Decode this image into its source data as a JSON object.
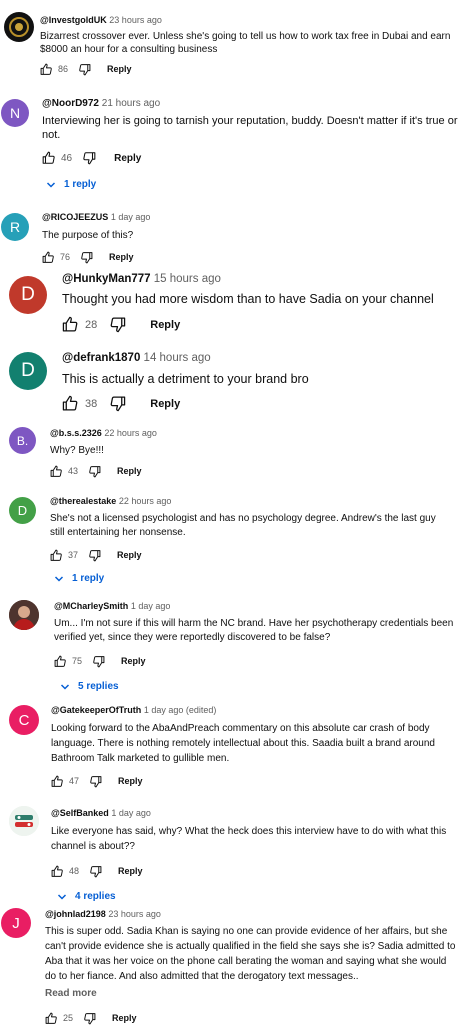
{
  "labels": {
    "reply": "Reply",
    "read_more": "Read more"
  },
  "comments": [
    {
      "handle": "@InvestgoldUK",
      "time": "23 hours ago",
      "text": "Bizarrest crossover ever.  Unless she's going to tell us how to work tax free in Dubai and earn $8000 an hour for a consulting business",
      "likes": "86",
      "avatar": ""
    },
    {
      "handle": "@NoorD972",
      "time": "21 hours ago",
      "text": "Interviewing her is going to tarnish your reputation, buddy. Doesn't matter if it's true or not.",
      "likes": "46",
      "avatar": "N",
      "replies": "1 reply"
    },
    {
      "handle": "@RICOJEEZUS",
      "time": "1 day ago",
      "text": "The purpose of this?",
      "likes": "76",
      "avatar": "R"
    },
    {
      "handle": "@HunkyMan777",
      "time": "15 hours ago",
      "text": "Thought you had more wisdom than to have Sadia on your channel",
      "likes": "28",
      "avatar": "D"
    },
    {
      "handle": "@defrank1870",
      "time": "14 hours ago",
      "text": "This is actually a detriment to your brand bro",
      "likes": "38",
      "avatar": "D"
    },
    {
      "handle": "@b.s.s.2326",
      "time": "22 hours ago",
      "text": "Why?  Bye!!!",
      "likes": "43",
      "avatar": "B."
    },
    {
      "handle": "@therealestake",
      "time": "22 hours ago",
      "text": "She's not a licensed psychologist and has no psychology degree.  Andrew's the last guy still entertaining her nonsense.",
      "likes": "37",
      "avatar": "D",
      "replies": "1 reply"
    },
    {
      "handle": "@MCharleySmith",
      "time": "1 day ago",
      "text": "Um... I'm not sure if this will harm the NC brand. Have her psychotherapy credentials been verified yet, since they were reportedly discovered to be false?",
      "likes": "75",
      "avatar": "",
      "replies": "5 replies"
    },
    {
      "handle": "@GatekeeperOfTruth",
      "time": "1 day ago (edited)",
      "text": "Looking forward to the AbaAndPreach commentary on this absolute car crash of body language. There is nothing remotely intellectual about this. Saadia built a brand around Bathroom Talk marketed to gullible men.",
      "likes": "47",
      "avatar": "C"
    },
    {
      "handle": "@SelfBanked",
      "time": "1 day ago",
      "text": "Like everyone has said, why? What the heck does this interview have to do with what this channel is about??",
      "likes": "48",
      "avatar": "",
      "replies": "4 replies"
    },
    {
      "handle": "@johnlad2198",
      "time": "23 hours ago",
      "text": "This is super odd. Sadia Khan is saying no one can provide evidence of her affairs, but she can't provide evidence she is actually qualified in the field she says she is? Sadia admitted to Aba that it was her voice on the phone call berating the woman and saying what she would do to her fiance. And also admitted that the derogatory text messages..",
      "likes": "25",
      "avatar": "J"
    }
  ],
  "colors": {
    "link_blue": "#065fd4",
    "secondary": "#606060"
  }
}
